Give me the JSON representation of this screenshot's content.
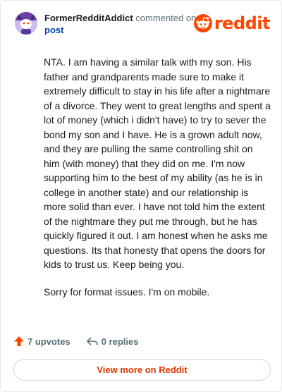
{
  "header": {
    "author": "FormerRedditAddict",
    "action_text": "commented on",
    "post_link": "post",
    "logo_text": "reddit"
  },
  "comment": {
    "paragraphs": [
      "NTA. I am having a similar talk with my son. His father and grandparents made sure to make it extremely difficult to stay in his life after a nightmare of a divorce. They went to great lengths and spent a lot of money (which i didn't have) to try to sever the bond my son and I have. He is a grown adult now, and they are pulling the same controlling shit on him (with money) that they did on me. I'm now supporting him to the best of my ability (as he is in college in another state) and our relationship is more solid than ever. I have not told him the extent of the nightmare they put me through, but he has quickly figured it out. I am honest when he asks me questions. Its that honesty that opens the doors for kids to trust us. Keep being you.",
      "Sorry for format issues. I'm on mobile."
    ]
  },
  "actions": {
    "upvotes": "7 upvotes",
    "replies": "0 replies"
  },
  "footer": {
    "view_more": "View more on Reddit"
  },
  "colors": {
    "brand": "#ff4500",
    "link": "#0045ac",
    "muted": "#576f76"
  },
  "icons": {
    "avatar": "avatar-image",
    "logo": "reddit-snoo-icon",
    "upvote": "upvote-arrow-icon",
    "reply": "reply-arrow-icon"
  }
}
